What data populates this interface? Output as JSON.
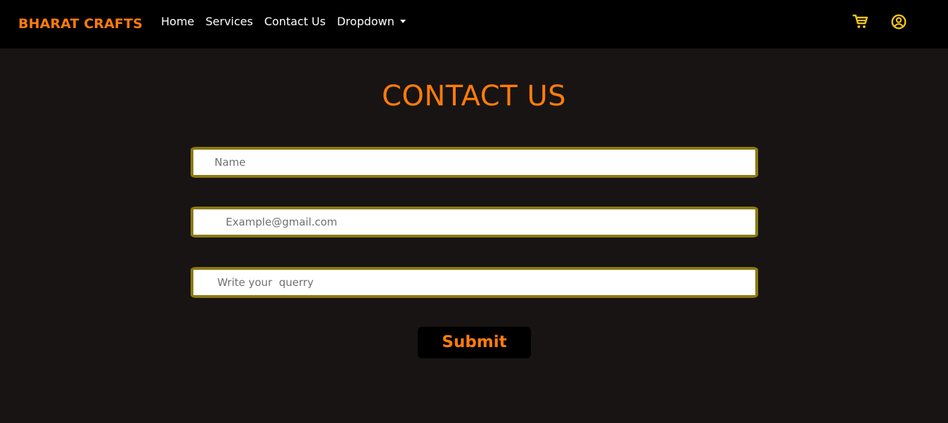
{
  "navbar": {
    "brand": "BHARAT CRAFTS",
    "links": [
      "Home",
      "Services",
      "Contact Us"
    ],
    "dropdown_label": "Dropdown",
    "icons": {
      "cart": "shopping-cart-icon",
      "user": "user-circle-icon"
    }
  },
  "main": {
    "title": "CONTACT US",
    "form": {
      "name_placeholder": "Name",
      "email_placeholder": "Example@gmail.com",
      "query_placeholder": "Write your  querry",
      "submit_label": "Submit"
    }
  },
  "colors": {
    "accent": "#ff7c0a",
    "icon": "#f5c518",
    "background": "#181414",
    "navbar": "#000000",
    "field_border": "#8a7a10"
  }
}
